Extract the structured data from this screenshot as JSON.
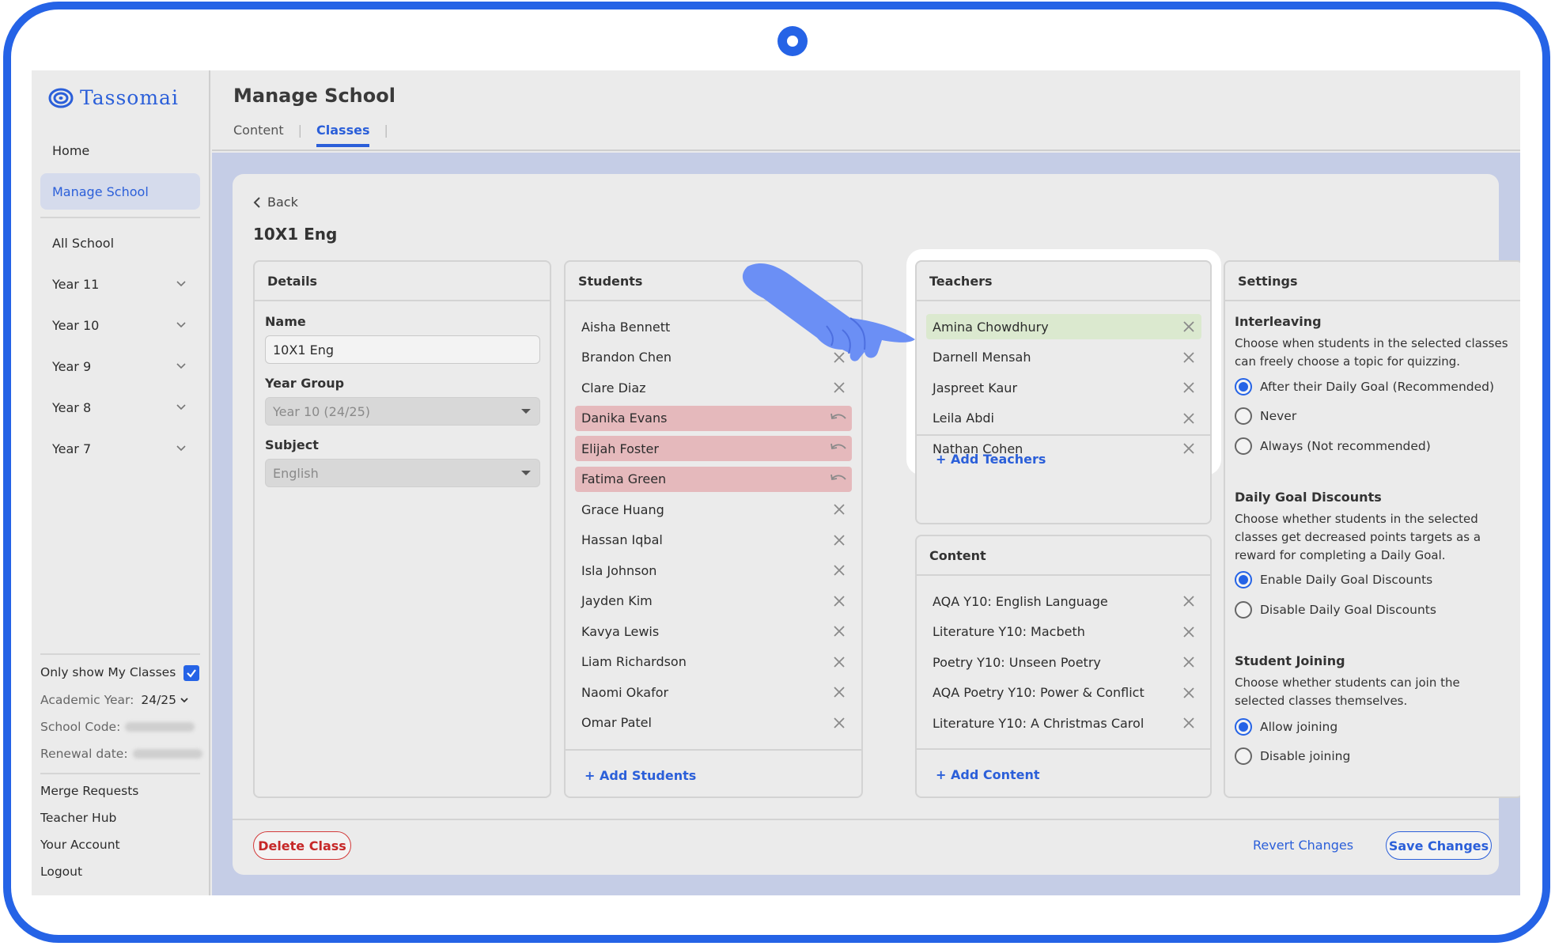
{
  "brand": {
    "name": "Tassomai"
  },
  "sidebar": {
    "nav": [
      {
        "label": "Home"
      },
      {
        "label": "Manage School"
      },
      {
        "label": "All School"
      },
      {
        "label": "Year 11"
      },
      {
        "label": "Year 10"
      },
      {
        "label": "Year 9"
      },
      {
        "label": "Year 8"
      },
      {
        "label": "Year 7"
      }
    ],
    "only_my_classes": "Only show My Classes",
    "academic_year_label": "Academic Year:",
    "academic_year_value": "24/25",
    "school_code_label": "School Code:",
    "renewal_label": "Renewal date:",
    "links": [
      "Merge Requests",
      "Teacher Hub",
      "Your Account",
      "Logout"
    ]
  },
  "header": {
    "title": "Manage School",
    "tabs": [
      "Content",
      "Classes"
    ]
  },
  "page": {
    "back": "Back",
    "class_title": "10X1 Eng"
  },
  "details": {
    "title": "Details",
    "name_label": "Name",
    "name_value": "10X1 Eng",
    "year_label": "Year Group",
    "year_value": "Year 10 (24/25)",
    "subject_label": "Subject",
    "subject_value": "English"
  },
  "students": {
    "title": "Students",
    "items": [
      "Aisha Bennett",
      "Brandon Chen",
      "Clare Diaz",
      "Danika Evans",
      "Elijah Foster",
      "Fatima Green",
      "Grace Huang",
      "Hassan Iqbal",
      "Isla Johnson",
      "Jayden Kim",
      "Kavya Lewis",
      "Liam Richardson",
      "Naomi Okafor",
      "Omar Patel"
    ],
    "add": "+ Add Students"
  },
  "teachers": {
    "title": "Teachers",
    "items": [
      "Amina Chowdhury",
      "Darnell Mensah",
      "Jaspreet Kaur",
      "Leila Abdi",
      "Nathan Cohen"
    ],
    "add": "+ Add Teachers"
  },
  "content": {
    "title": "Content",
    "items": [
      "AQA Y10: English Language",
      "Literature Y10: Macbeth",
      "Poetry Y10: Unseen Poetry",
      "AQA Poetry Y10: Power & Conflict",
      "Literature Y10: A Christmas Carol"
    ],
    "add": "+ Add Content"
  },
  "settings": {
    "title": "Settings",
    "interleaving": {
      "title": "Interleaving",
      "desc": "Choose when students in the selected classes can freely choose a topic for quizzing.",
      "options": [
        "After their Daily Goal (Recommended)",
        "Never",
        "Always (Not recommended)"
      ]
    },
    "discounts": {
      "title": "Daily Goal Discounts",
      "desc": "Choose whether students in the selected classes get decreased points targets as a reward for completing a Daily Goal.",
      "options": [
        "Enable Daily Goal Discounts",
        "Disable Daily Goal Discounts"
      ]
    },
    "joining": {
      "title": "Student Joining",
      "desc": "Choose whether students can join the selected classes themselves.",
      "options": [
        "Allow joining",
        "Disable joining"
      ]
    }
  },
  "actions": {
    "delete": "Delete Class",
    "revert": "Revert Changes",
    "save": "Save Changes"
  },
  "colors": {
    "accent": "#2b5fd9",
    "device": "#2563e6",
    "removed_row": "#e5b9bc",
    "added_row": "#dbe9cf",
    "danger": "#c62828"
  }
}
